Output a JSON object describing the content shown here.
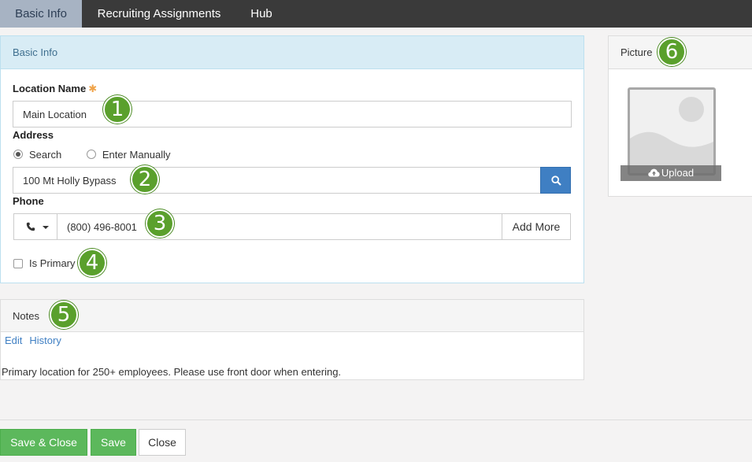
{
  "nav": {
    "tabs": [
      {
        "label": "Basic Info",
        "active": true
      },
      {
        "label": "Recruiting Assignments",
        "active": false
      },
      {
        "label": "Hub",
        "active": false
      }
    ]
  },
  "basic_info": {
    "panel_title": "Basic Info",
    "location_name_label": "Location Name",
    "required_mark": "✱",
    "location_name_value": "Main Location",
    "address_label": "Address",
    "address_mode_options": [
      "Search",
      "Enter Manually"
    ],
    "address_mode_selected": "Search",
    "address_value": "100 Mt Holly Bypass",
    "phone_label": "Phone",
    "phone_value": "(800) 496-8001",
    "add_more_label": "Add More",
    "is_primary_label": "Is Primary",
    "is_primary_checked": false
  },
  "notes": {
    "panel_title": "Notes",
    "links": [
      "Edit",
      "History"
    ],
    "text": "Primary location for 250+ employees. Please use front door when entering."
  },
  "picture": {
    "panel_title": "Picture",
    "upload_label": "Upload"
  },
  "footer": {
    "save_close_label": "Save & Close",
    "save_label": "Save",
    "close_label": "Close"
  },
  "markers": [
    "1",
    "2",
    "3",
    "4",
    "5",
    "6"
  ],
  "colors": {
    "nav_bg": "#3a3a3a",
    "active_tab_bg": "#a7b3c3",
    "info_header_bg": "#d8ecf5",
    "primary_blue": "#3f7fc3",
    "success_green": "#5cb85c",
    "marker_green": "#5aa02c",
    "required_orange": "#f0a44a"
  },
  "icons": {
    "search_button": "search-icon",
    "phone_type": "phone-icon",
    "upload": "cloud-upload-icon",
    "placeholder": "image-placeholder-icon"
  }
}
